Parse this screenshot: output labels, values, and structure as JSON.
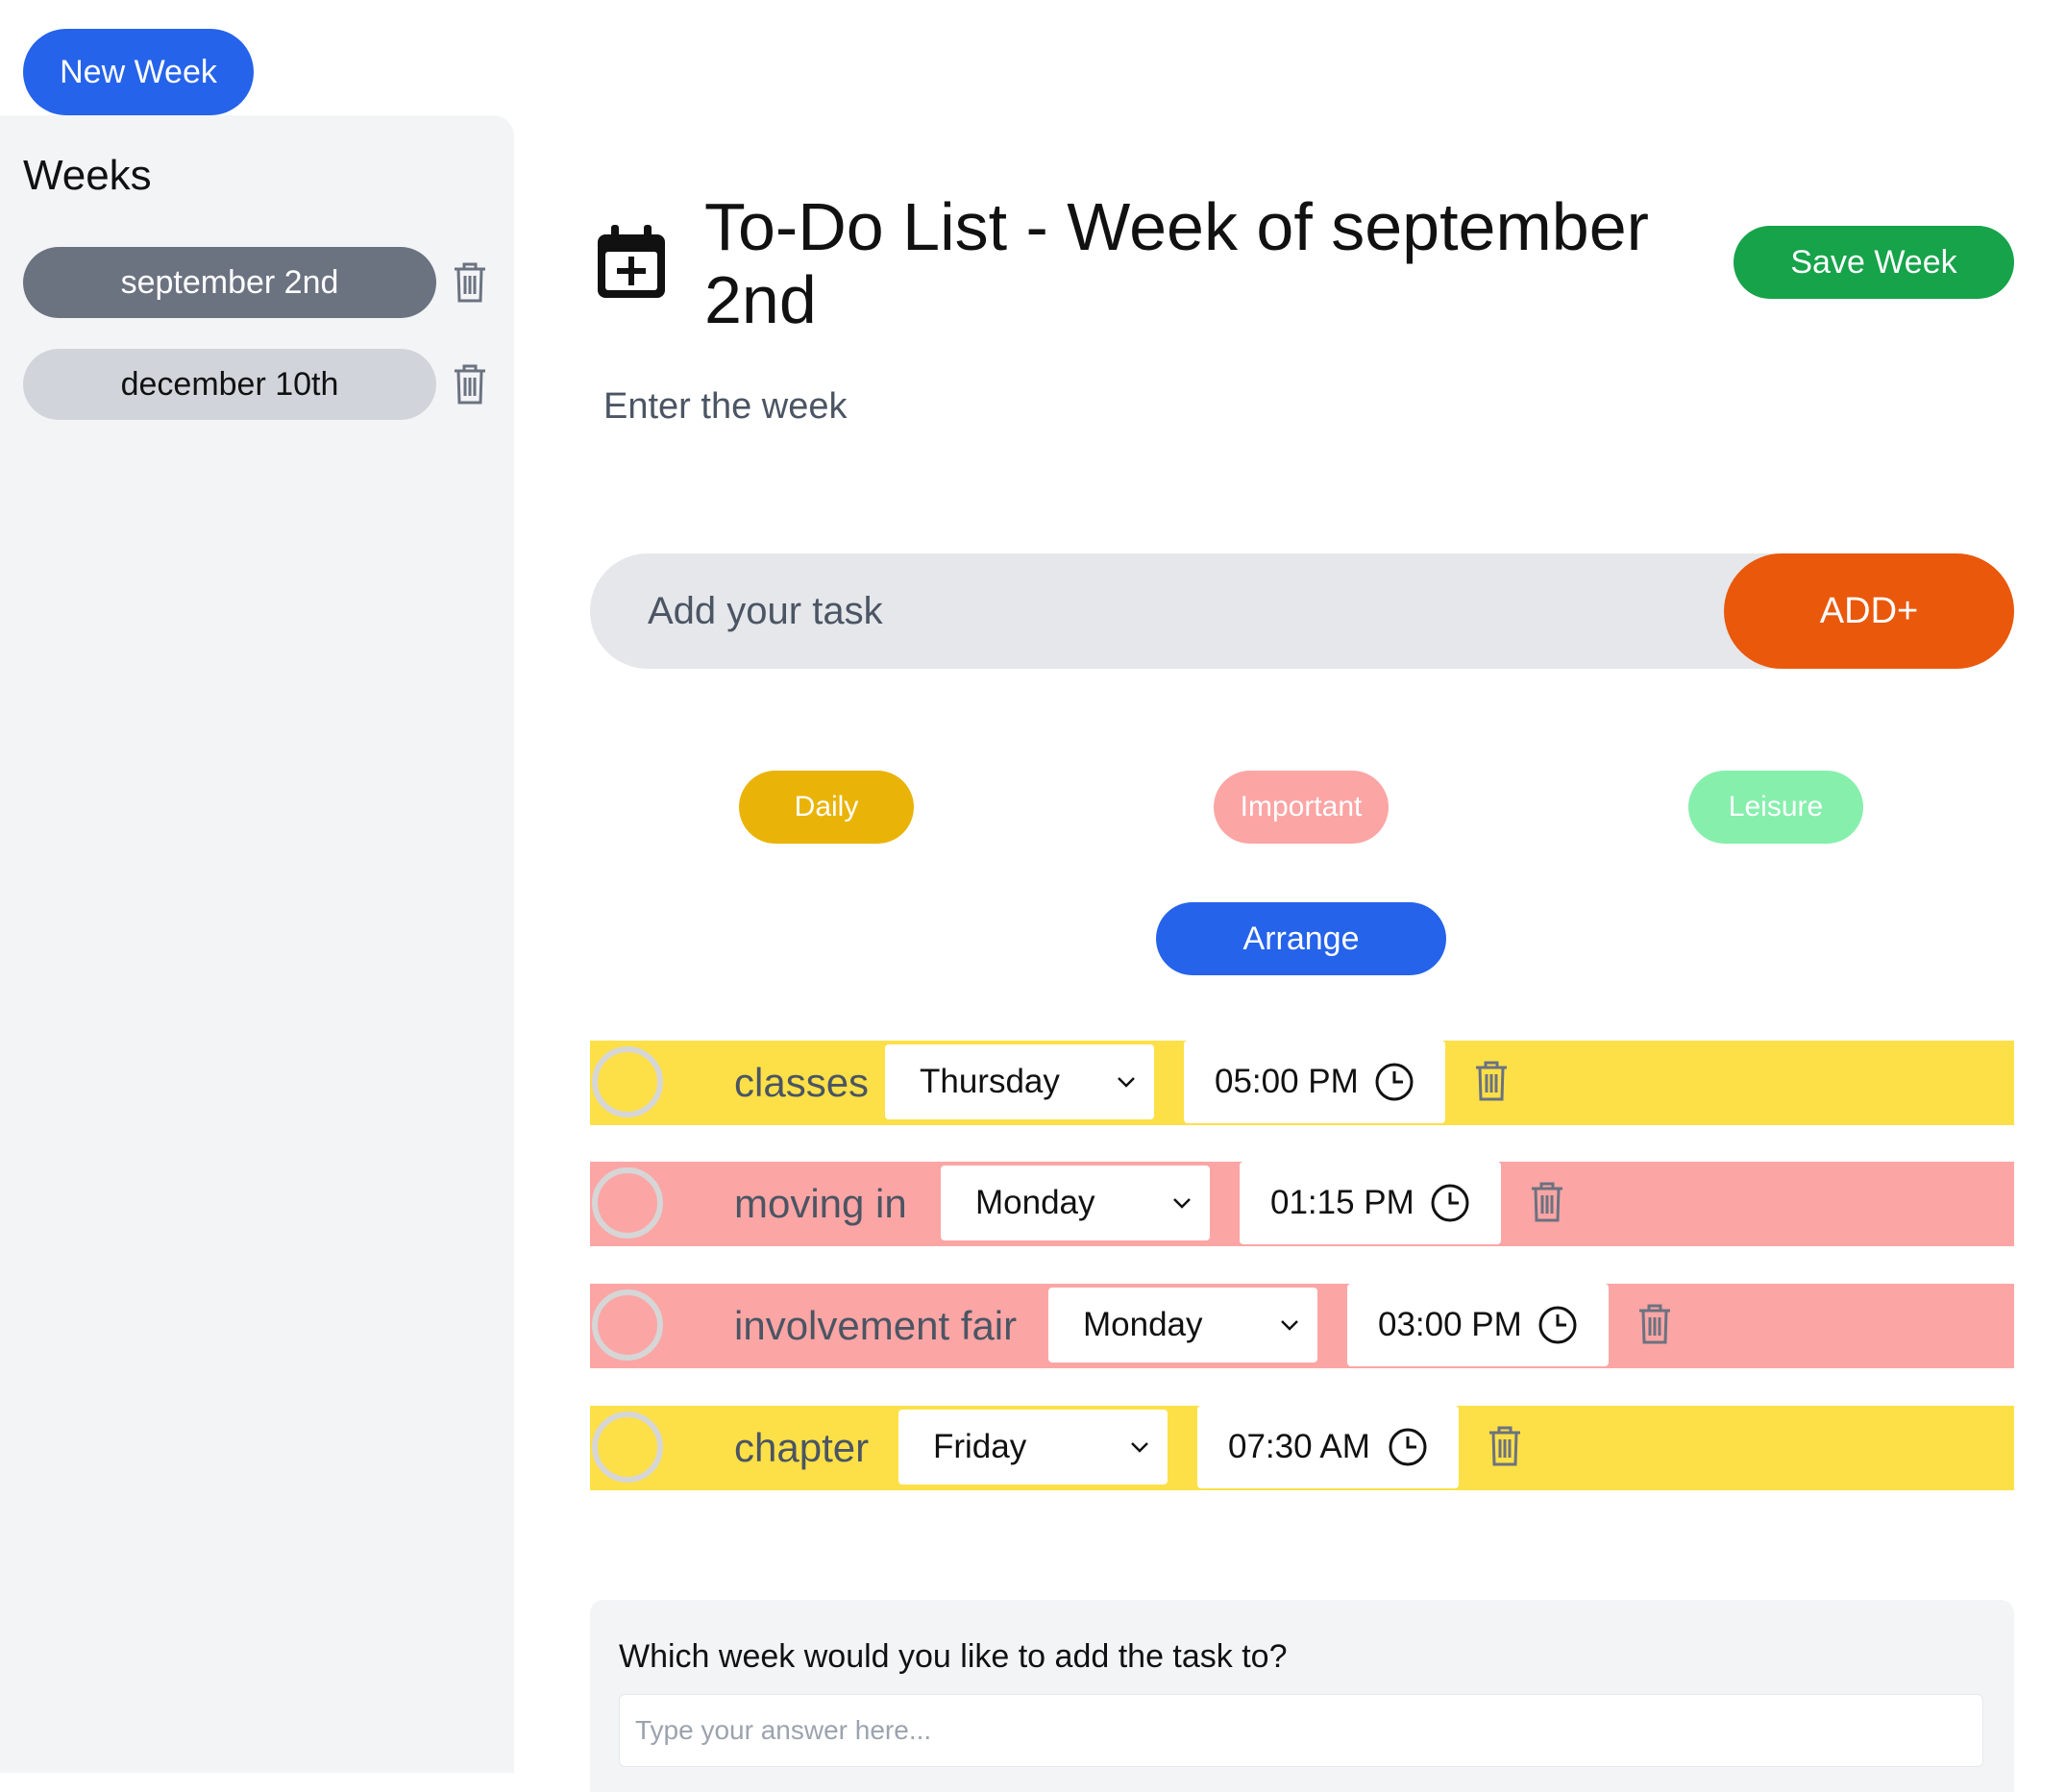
{
  "toolbar": {
    "new_week_label": "New Week"
  },
  "sidebar": {
    "title": "Weeks",
    "weeks": [
      {
        "label": "september 2nd",
        "selected": true
      },
      {
        "label": "december 10th",
        "selected": false
      }
    ]
  },
  "header": {
    "title": "To-Do List - Week of september 2nd",
    "save_label": "Save Week",
    "subtitle": "Enter the week"
  },
  "task_entry": {
    "placeholder": "Add your task",
    "add_label": "ADD+"
  },
  "filters": {
    "daily": "Daily",
    "important": "Important",
    "leisure": "Leisure",
    "arrange": "Arrange"
  },
  "tasks": [
    {
      "name": "classes",
      "day": "Thursday",
      "time": "05:00 PM",
      "category": "Daily"
    },
    {
      "name": "moving in",
      "day": "Monday",
      "time": "01:15 PM",
      "category": "Important"
    },
    {
      "name": "involvement fair",
      "day": "Monday",
      "time": "03:00 PM",
      "category": "Important"
    },
    {
      "name": "chapter",
      "day": "Friday",
      "time": "07:30 AM",
      "category": "Daily"
    }
  ],
  "question": {
    "label": "Which week would you like to add the task to?",
    "placeholder": "Type your answer here..."
  },
  "colors": {
    "primary": "#2563eb",
    "save": "#16a34a",
    "add": "#ea580c",
    "daily": "#eab308",
    "daily_row": "#fde047",
    "important": "#fca5a5",
    "leisure": "#86efac"
  },
  "icons": {
    "calendar": "calendar-plus-icon",
    "trash": "trash-icon",
    "chevron": "chevron-down-icon",
    "clock": "clock-icon",
    "check": "circle-check-icon"
  }
}
